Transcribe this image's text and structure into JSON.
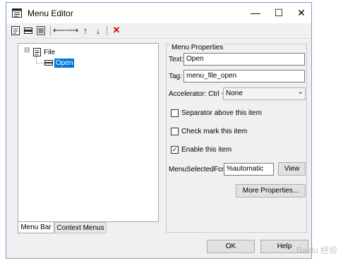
{
  "window": {
    "title": "Menu Editor",
    "minimize_glyph": "—",
    "maximize_glyph": "☐",
    "close_glyph": "✕"
  },
  "toolbar": {
    "icons": [
      "new-menu-icon",
      "new-menu-item-icon",
      "new-context-menu-icon",
      "move-left-icon",
      "move-right-icon",
      "move-up-icon",
      "move-down-icon",
      "delete-icon"
    ],
    "glyphs": {
      "move_left": "⟵",
      "move_right": "⟶",
      "move_up": "↑",
      "move_down": "↓",
      "delete": "✕"
    }
  },
  "tree": {
    "collapse_glyph": "⊟",
    "items": [
      {
        "label": "File"
      },
      {
        "label": "Open",
        "selected": true
      }
    ]
  },
  "tabs": [
    {
      "label": "Menu Bar",
      "active": true
    },
    {
      "label": "Context Menus",
      "active": false
    }
  ],
  "properties": {
    "legend": "Menu Properties",
    "text_label": "Text:",
    "text_value": "Open",
    "tag_label": "Tag:",
    "tag_value": "menu_file_open",
    "accelerator_label": "Accelerator: Ctrl +",
    "accelerator_value": "None",
    "separator_label": "Separator above this item",
    "separator_checked": false,
    "checkmark_label": "Check mark this item",
    "checkmark_checked": false,
    "enable_label": "Enable this item",
    "enable_checked": true,
    "check_glyph": "✓",
    "dropdown_glyph": "⌄",
    "callback_label": "MenuSelectedFcn:",
    "callback_value": "%automatic",
    "view_button": "View",
    "more_button": "More Properties..."
  },
  "footer": {
    "ok_button": "OK",
    "help_button": "Help"
  },
  "watermark": "Baidu 经验",
  "colors": {
    "selection": "#0078d7",
    "delete_red": "#d00000"
  }
}
